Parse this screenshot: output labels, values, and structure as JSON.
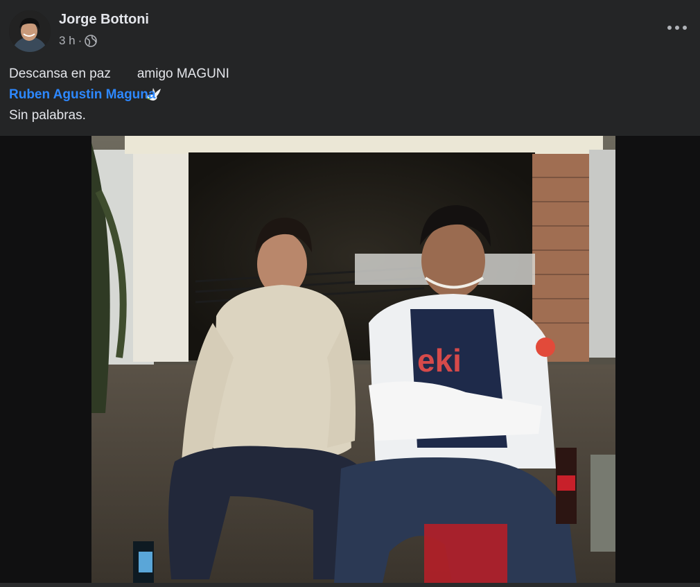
{
  "post": {
    "author": "Jorge Bottoni",
    "time": "3 h",
    "separator": "·",
    "privacy_icon": "globe-icon",
    "more_icon": "more-options-icon",
    "text_line1_part1": "Descansa en paz",
    "emoji": "dove-icon",
    "text_line1_part2": "amigo MAGUNI",
    "mention": "Ruben Agustin Maguna",
    "text_line3": "Sin palabras."
  },
  "photo": {
    "description_icon": "post-photo"
  },
  "colors": {
    "background": "#242526",
    "text": "#e4e6eb",
    "secondary": "#b0b3b8",
    "link": "#2d88ff"
  }
}
